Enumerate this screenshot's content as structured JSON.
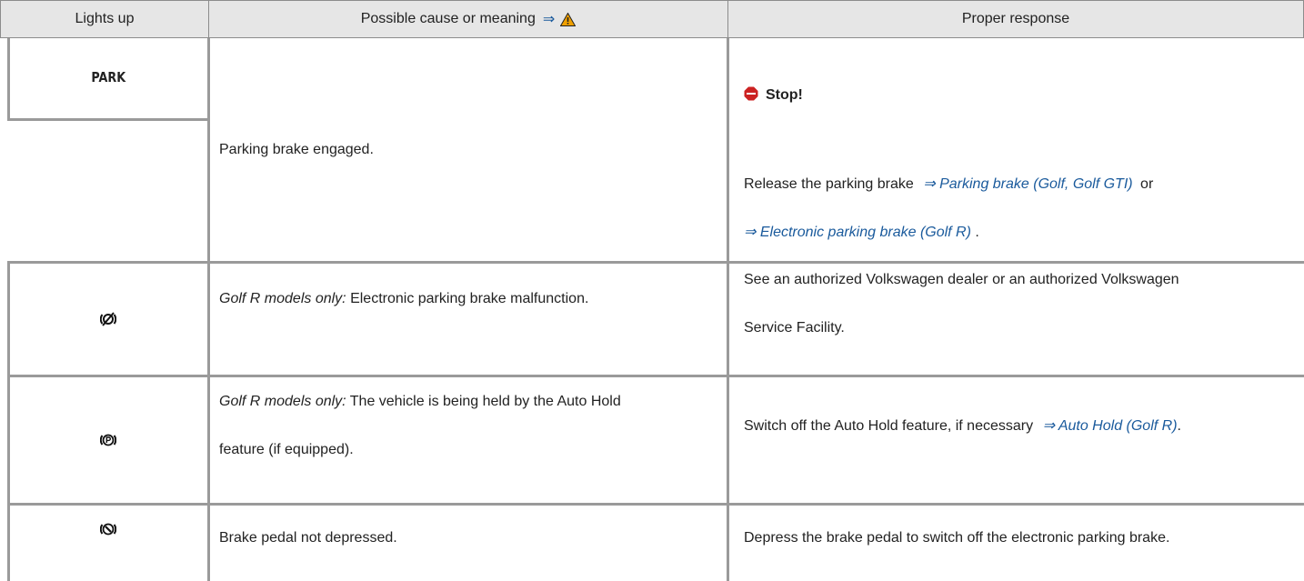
{
  "header": {
    "col1": "Lights up",
    "col2": "Possible cause or meaning",
    "col2_arrow": "⇒",
    "col3": "Proper response"
  },
  "rows": [
    {
      "icon_label": "PARK",
      "cause": "Parking brake engaged.",
      "response_stop": "Stop!",
      "response_line1_prefix": "Release the parking brake",
      "response_line1_link": "⇒ Parking brake (Golf, Golf GTI)",
      "response_line1_suffix": "or",
      "response_line2_link": "⇒ Electronic parking brake (Golf R)",
      "response_line2_suffix": "."
    },
    {
      "icon": "parking-brake-malfunction-icon",
      "cause_italic": "Golf R models only:",
      "cause": "Electronic parking brake malfunction.",
      "response_line1": "See an authorized Volkswagen dealer or an authorized Volkswagen",
      "response_line2": "Service Facility."
    },
    {
      "icon": "auto-hold-icon",
      "cause_italic": "Golf R models only:",
      "cause_line1": "The vehicle is being held by the Auto Hold",
      "cause_line2": "feature (if equipped).",
      "response_prefix": "Switch off the Auto Hold feature, if necessary",
      "response_link": "⇒ Auto Hold (Golf R)",
      "response_suffix": "."
    },
    {
      "icon": "brake-pedal-icon",
      "cause": "Brake pedal not depressed.",
      "response": "Depress the brake pedal to switch off the electronic parking brake."
    }
  ],
  "colors": {
    "header_bg": "#e6e6e6",
    "border": "#8c8c8c",
    "link": "#1a5a9c",
    "warning": "#f0a000",
    "stop": "#cc2222"
  }
}
